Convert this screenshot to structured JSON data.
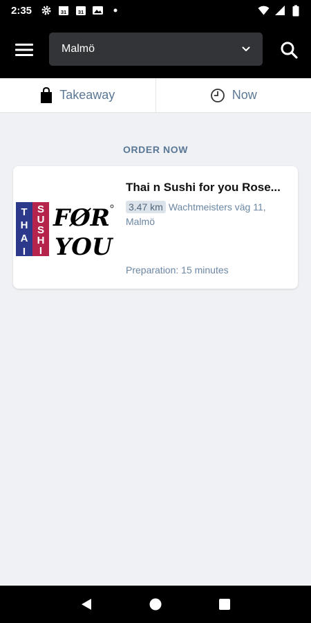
{
  "status_bar": {
    "time": "2:35",
    "calendar_day_1": "31",
    "calendar_day_2": "31"
  },
  "header": {
    "location_value": "Malmö"
  },
  "modes": [
    {
      "label": "Takeaway",
      "icon": "shopping-bag-icon"
    },
    {
      "label": "Now",
      "icon": "clock-icon"
    }
  ],
  "section": {
    "title": "ORDER NOW"
  },
  "restaurant": {
    "name": "Thai n Sushi for you Rose...",
    "distance": "3.47 km",
    "address": "Wachtmeisters väg 11, Malmö",
    "preparation": "Preparation: 15 minutes",
    "logo": {
      "thai_letters": [
        "T",
        "H",
        "A",
        "I"
      ],
      "sushi_letters": [
        "S",
        "U",
        "S",
        "H",
        "I"
      ],
      "line1": "FØR",
      "line2": "YOU",
      "thai_color": "#2d3a8c",
      "sushi_color": "#b5244a"
    }
  },
  "colors": {
    "accent_text": "#5a7896",
    "background": "#eff1f4",
    "header": "#000000",
    "select_bg": "#333437"
  }
}
